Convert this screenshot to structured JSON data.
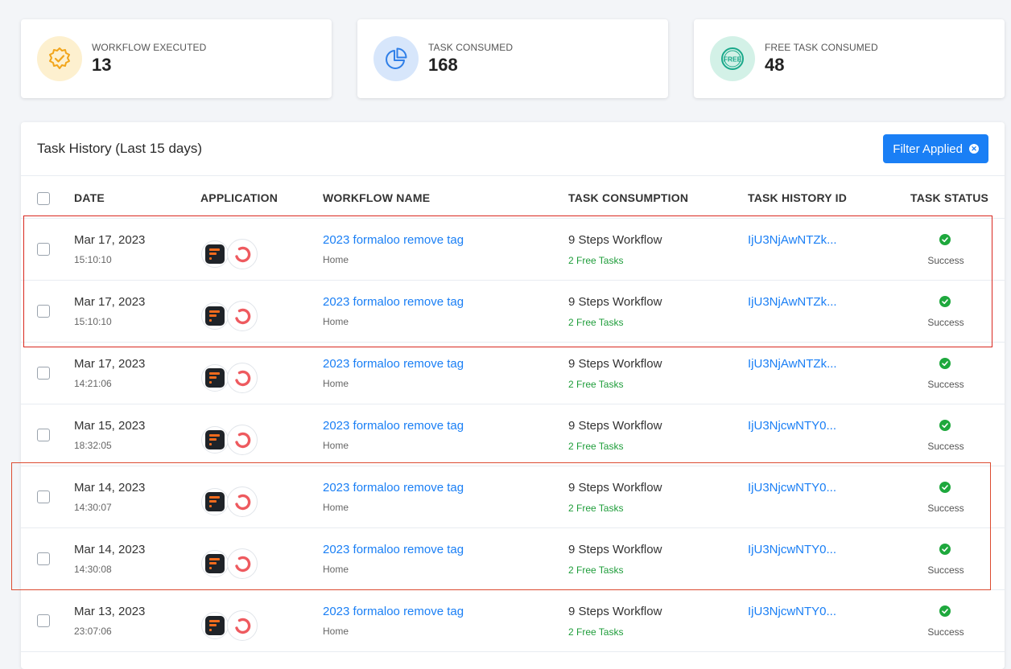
{
  "stats": [
    {
      "label": "WORKFLOW EXECUTED",
      "value": "13",
      "icon": "badge-check-icon",
      "bg": "#fdf0cf",
      "color": "#f2a51a"
    },
    {
      "label": "TASK CONSUMED",
      "value": "168",
      "icon": "pie-chart-icon",
      "bg": "#d7e6fb",
      "color": "#2f7fe8"
    },
    {
      "label": "FREE TASK CONSUMED",
      "value": "48",
      "icon": "free-badge-icon",
      "bg": "#d3f1e7",
      "color": "#1aa88a"
    }
  ],
  "panel": {
    "title": "Task History (Last 15 days)",
    "filter_label": "Filter Applied"
  },
  "columns": [
    "DATE",
    "APPLICATION",
    "WORKFLOW NAME",
    "TASK CONSUMPTION",
    "TASK HISTORY ID",
    "TASK STATUS"
  ],
  "rows": [
    {
      "date": "Mar 17, 2023",
      "time": "15:10:10",
      "workflow": "2023 formaloo remove tag",
      "folder": "Home",
      "steps": "9 Steps Workflow",
      "free": "2 Free Tasks",
      "id": "IjU3NjAwNTZk...",
      "status": "Success"
    },
    {
      "date": "Mar 17, 2023",
      "time": "15:10:10",
      "workflow": "2023 formaloo remove tag",
      "folder": "Home",
      "steps": "9 Steps Workflow",
      "free": "2 Free Tasks",
      "id": "IjU3NjAwNTZk...",
      "status": "Success"
    },
    {
      "date": "Mar 17, 2023",
      "time": "14:21:06",
      "workflow": "2023 formaloo remove tag",
      "folder": "Home",
      "steps": "9 Steps Workflow",
      "free": "2 Free Tasks",
      "id": "IjU3NjAwNTZk...",
      "status": "Success"
    },
    {
      "date": "Mar 15, 2023",
      "time": "18:32:05",
      "workflow": "2023 formaloo remove tag",
      "folder": "Home",
      "steps": "9 Steps Workflow",
      "free": "2 Free Tasks",
      "id": "IjU3NjcwNTY0...",
      "status": "Success"
    },
    {
      "date": "Mar 14, 2023",
      "time": "14:30:07",
      "workflow": "2023 formaloo remove tag",
      "folder": "Home",
      "steps": "9 Steps Workflow",
      "free": "2 Free Tasks",
      "id": "IjU3NjcwNTY0...",
      "status": "Success"
    },
    {
      "date": "Mar 14, 2023",
      "time": "14:30:08",
      "workflow": "2023 formaloo remove tag",
      "folder": "Home",
      "steps": "9 Steps Workflow",
      "free": "2 Free Tasks",
      "id": "IjU3NjcwNTY0...",
      "status": "Success"
    },
    {
      "date": "Mar 13, 2023",
      "time": "23:07:06",
      "workflow": "2023 formaloo remove tag",
      "folder": "Home",
      "steps": "9 Steps Workflow",
      "free": "2 Free Tasks",
      "id": "IjU3NjcwNTY0...",
      "status": "Success"
    }
  ],
  "colors": {
    "accent": "#1a7ff5",
    "success": "#1ea83d",
    "free_text": "#1e9d3a",
    "highlight_red": "#d9281f",
    "highlight_orange": "#dc4b30"
  }
}
